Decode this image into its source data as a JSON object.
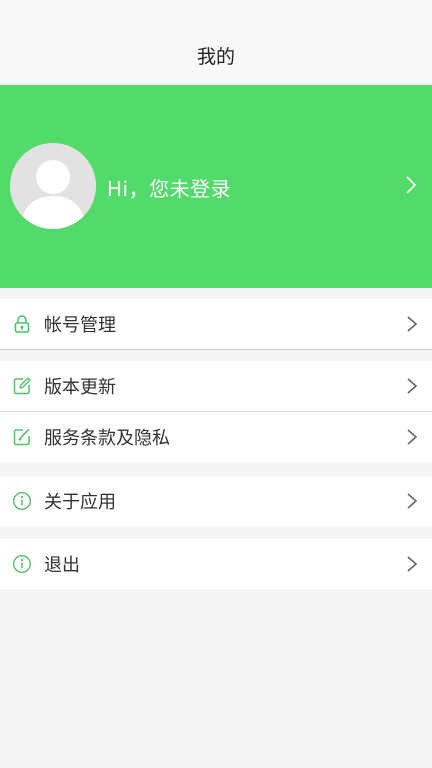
{
  "header": {
    "title": "我的"
  },
  "profile": {
    "greeting": "Hi，您未登录"
  },
  "menu": {
    "account": "帐号管理",
    "version": "版本更新",
    "terms": "服务条款及隐私",
    "about": "关于应用",
    "logout": "退出"
  },
  "colors": {
    "accent": "#52da6a",
    "icon": "#52c26a",
    "chevron": "#666666"
  }
}
